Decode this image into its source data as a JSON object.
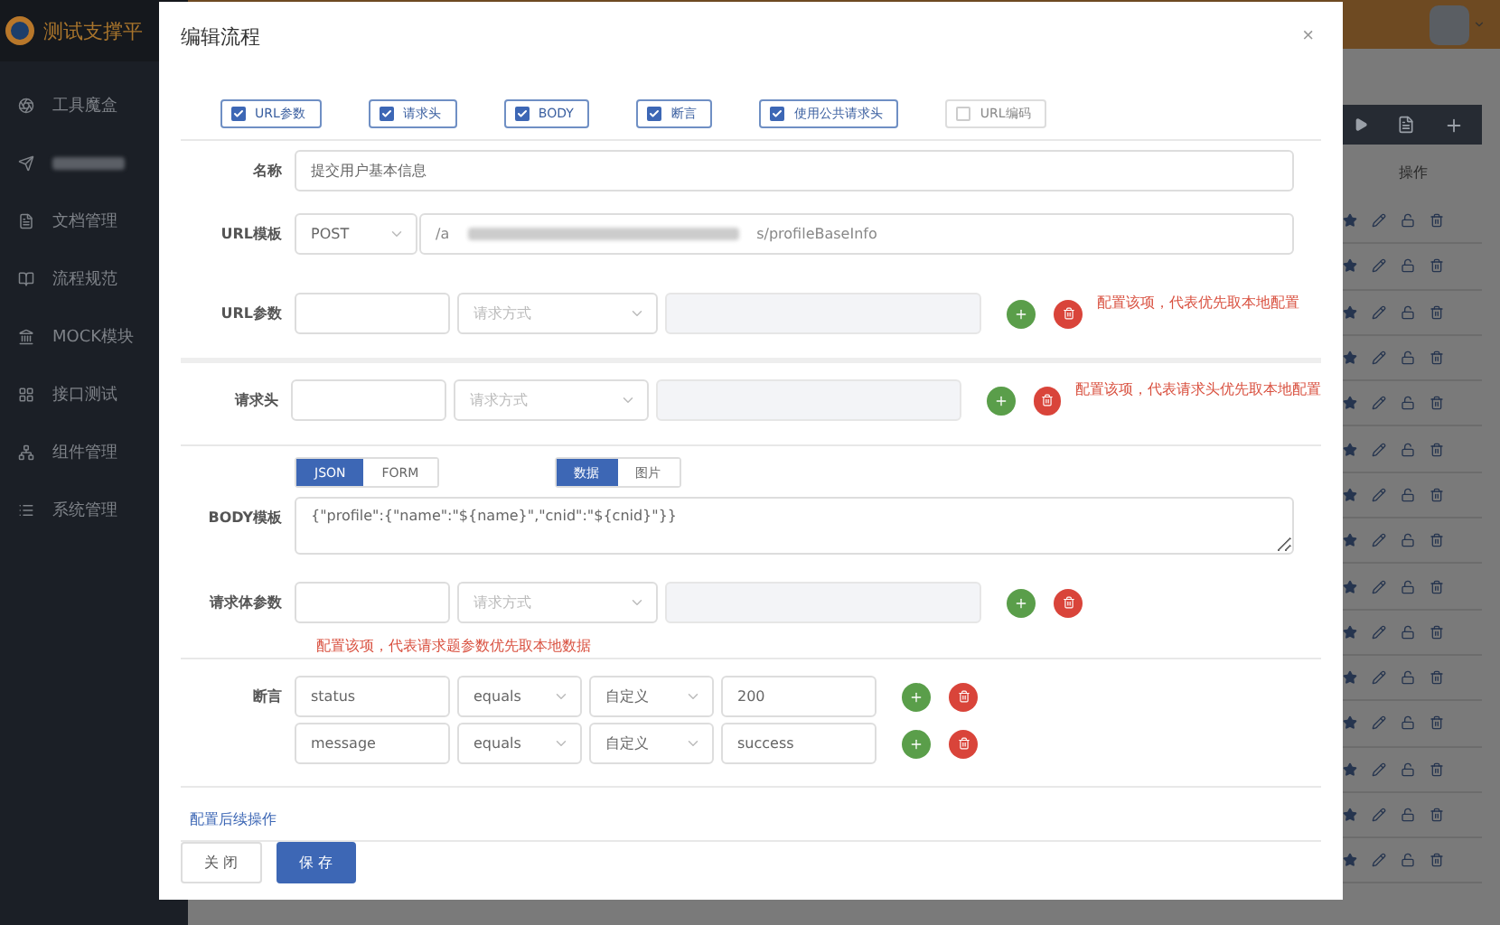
{
  "app": {
    "logo_text": "测试支撑平"
  },
  "sidebar": {
    "items": [
      {
        "kind": "text",
        "label": "工具魔盒"
      },
      {
        "kind": "blurred"
      },
      {
        "kind": "text",
        "label": "文档管理"
      },
      {
        "kind": "text",
        "label": "流程规范"
      },
      {
        "kind": "text",
        "label": "MOCK模块"
      },
      {
        "kind": "text",
        "label": "接口测试"
      },
      {
        "kind": "text",
        "label": "组件管理"
      },
      {
        "kind": "text",
        "label": "系统管理"
      }
    ]
  },
  "table": {
    "header": "操作"
  },
  "dialog": {
    "title": "编辑流程",
    "close": "×",
    "options": [
      {
        "label": "URL参数",
        "checked": true
      },
      {
        "label": "请求头",
        "checked": true
      },
      {
        "label": "BODY",
        "checked": true
      },
      {
        "label": "断言",
        "checked": true
      },
      {
        "label": "使用公共请求头",
        "checked": true
      },
      {
        "label": "URL编码",
        "checked": false
      }
    ],
    "name": {
      "label": "名称",
      "value": "提交用户基本信息"
    },
    "url_template": {
      "label": "URL模板",
      "method": "POST",
      "prefix": "/a",
      "suffix": "s/profileBaseInfo"
    },
    "url_params": {
      "label": "URL参数",
      "placeholder": "请求方式",
      "note": "配置该项，代表优先取本地配置"
    },
    "headers": {
      "label": "请求头",
      "placeholder": "请求方式",
      "note": "配置该项，代表请求头优先取本地配置"
    },
    "body_format": [
      {
        "label": "JSON",
        "selected": true
      },
      {
        "label": "FORM",
        "selected": false
      }
    ],
    "body_source": [
      {
        "label": "数据",
        "selected": true
      },
      {
        "label": "图片",
        "selected": false
      }
    ],
    "body_template": {
      "label": "BODY模板",
      "value": "{\"profile\":{\"name\":\"${name}\",\"cnid\":\"${cnid}\"}}"
    },
    "body_params": {
      "label": "请求体参数",
      "placeholder": "请求方式",
      "note": "配置该项，代表请求题参数优先取本地数据"
    },
    "assertions": {
      "label": "断言",
      "rows": [
        {
          "field": "status",
          "operator": "equals",
          "source": "自定义",
          "expected": "200"
        },
        {
          "field": "message",
          "operator": "equals",
          "source": "自定义",
          "expected": "success"
        }
      ]
    },
    "followup_link": "配置后续操作",
    "buttons": {
      "close": "关 闭",
      "save": "保 存"
    }
  }
}
